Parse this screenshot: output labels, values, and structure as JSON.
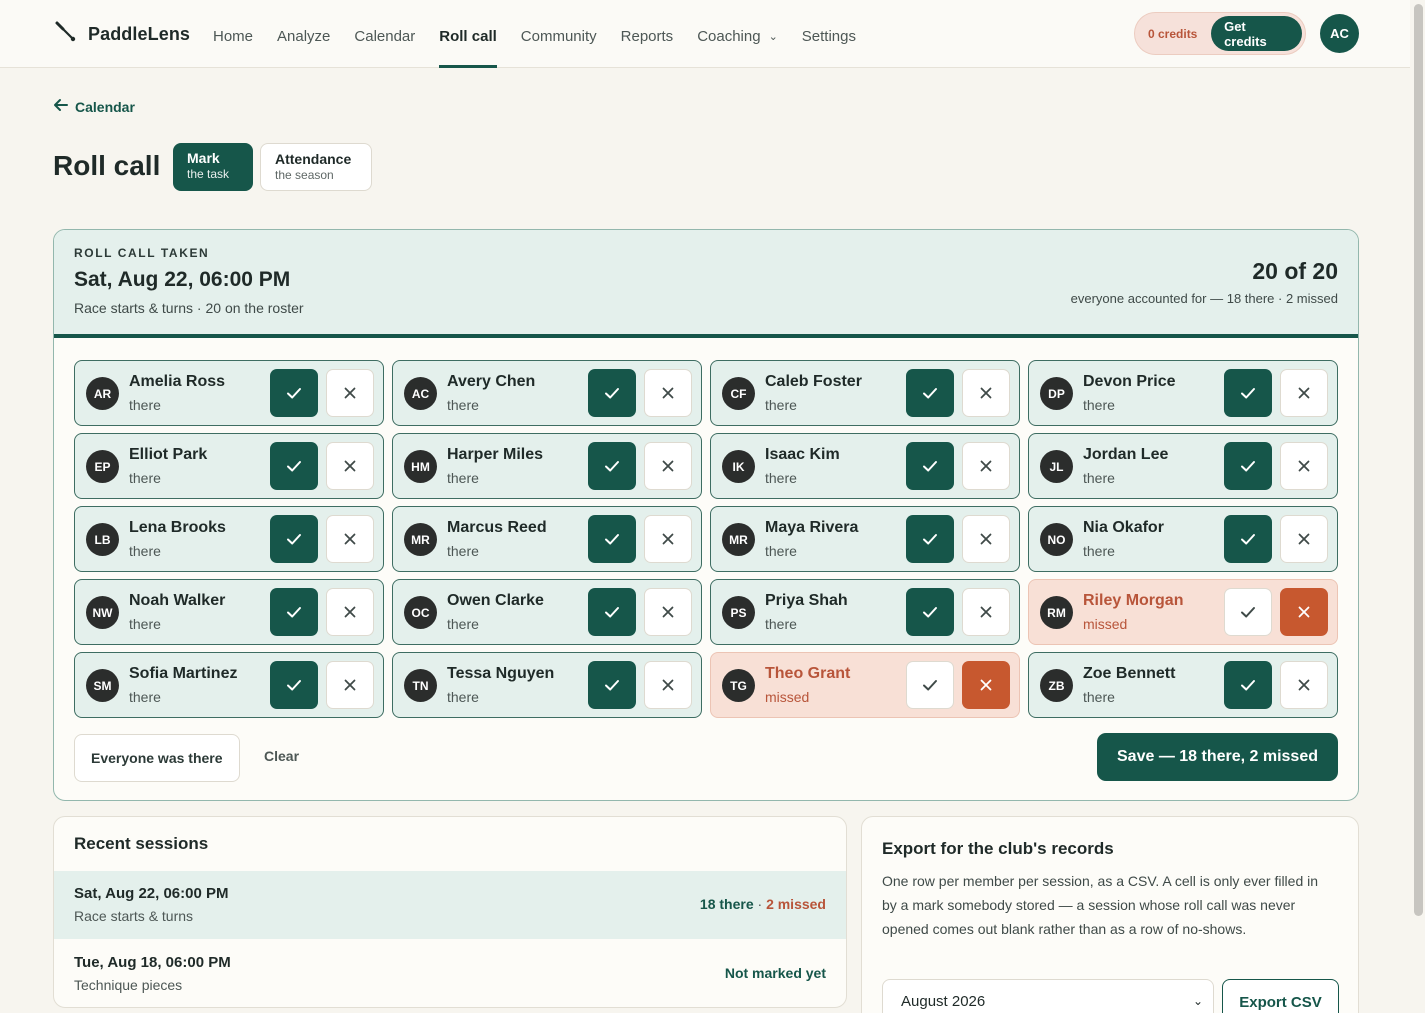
{
  "brand": {
    "name": "PaddleLens",
    "icon": "paddle-icon"
  },
  "nav": [
    {
      "label": "Home",
      "active": false
    },
    {
      "label": "Analyze",
      "active": false
    },
    {
      "label": "Calendar",
      "active": false
    },
    {
      "label": "Roll call",
      "active": true
    },
    {
      "label": "Community",
      "active": false
    },
    {
      "label": "Reports",
      "active": false
    },
    {
      "label": "Coaching",
      "active": false,
      "dropdown": true
    },
    {
      "label": "Settings",
      "active": false
    }
  ],
  "credits": {
    "label": "0 credits",
    "button": "Get credits"
  },
  "user": {
    "initials": "AC"
  },
  "back": {
    "label": "Calendar"
  },
  "page": {
    "title": "Roll call"
  },
  "modes": [
    {
      "title": "Mark",
      "sub": "the task",
      "active": true
    },
    {
      "title": "Attendance",
      "sub": "the season",
      "active": false
    }
  ],
  "session": {
    "eyebrow": "ROLL CALL TAKEN",
    "date": "Sat, Aug 22, 06:00 PM",
    "sub": "Race starts & turns · 20 on the roster",
    "tally": "20 of 20",
    "tally_sub": "everyone accounted for — 18 there · 2 missed"
  },
  "members": [
    {
      "initials": "AR",
      "name": "Amelia Ross",
      "status": "there"
    },
    {
      "initials": "AC",
      "name": "Avery Chen",
      "status": "there"
    },
    {
      "initials": "CF",
      "name": "Caleb Foster",
      "status": "there"
    },
    {
      "initials": "DP",
      "name": "Devon Price",
      "status": "there"
    },
    {
      "initials": "EP",
      "name": "Elliot Park",
      "status": "there"
    },
    {
      "initials": "HM",
      "name": "Harper Miles",
      "status": "there"
    },
    {
      "initials": "IK",
      "name": "Isaac Kim",
      "status": "there"
    },
    {
      "initials": "JL",
      "name": "Jordan Lee",
      "status": "there"
    },
    {
      "initials": "LB",
      "name": "Lena Brooks",
      "status": "there"
    },
    {
      "initials": "MR",
      "name": "Marcus Reed",
      "status": "there"
    },
    {
      "initials": "MR",
      "name": "Maya Rivera",
      "status": "there"
    },
    {
      "initials": "NO",
      "name": "Nia Okafor",
      "status": "there"
    },
    {
      "initials": "NW",
      "name": "Noah Walker",
      "status": "there"
    },
    {
      "initials": "OC",
      "name": "Owen Clarke",
      "status": "there"
    },
    {
      "initials": "PS",
      "name": "Priya Shah",
      "status": "there"
    },
    {
      "initials": "RM",
      "name": "Riley Morgan",
      "status": "missed"
    },
    {
      "initials": "SM",
      "name": "Sofia Martinez",
      "status": "there"
    },
    {
      "initials": "TN",
      "name": "Tessa Nguyen",
      "status": "there"
    },
    {
      "initials": "TG",
      "name": "Theo Grant",
      "status": "missed"
    },
    {
      "initials": "ZB",
      "name": "Zoe Bennett",
      "status": "there"
    }
  ],
  "actions": {
    "everyone": "Everyone was there",
    "clear": "Clear",
    "save": "Save — 18 there, 2 missed"
  },
  "recent": {
    "title": "Recent sessions",
    "rows": [
      {
        "date": "Sat, Aug 22, 06:00 PM",
        "sub": "Race starts & turns",
        "there": "18 there",
        "sep": "·",
        "missed": "2 missed"
      },
      {
        "date": "Tue, Aug 18, 06:00 PM",
        "sub": "Technique pieces",
        "status": "Not marked yet"
      }
    ]
  },
  "export": {
    "title": "Export for the club's records",
    "body": "One row per member per session, as a CSV. A cell is only ever filled in by a mark somebody stored — a session whose roll call was never opened comes out blank rather than as a row of no-shows.",
    "month": "August 2026",
    "button": "Export CSV"
  },
  "colors": {
    "accent": "#16564a",
    "missed": "#c7582f",
    "there_bg": "#e4f0ec",
    "missed_bg": "#f8e0d6"
  }
}
